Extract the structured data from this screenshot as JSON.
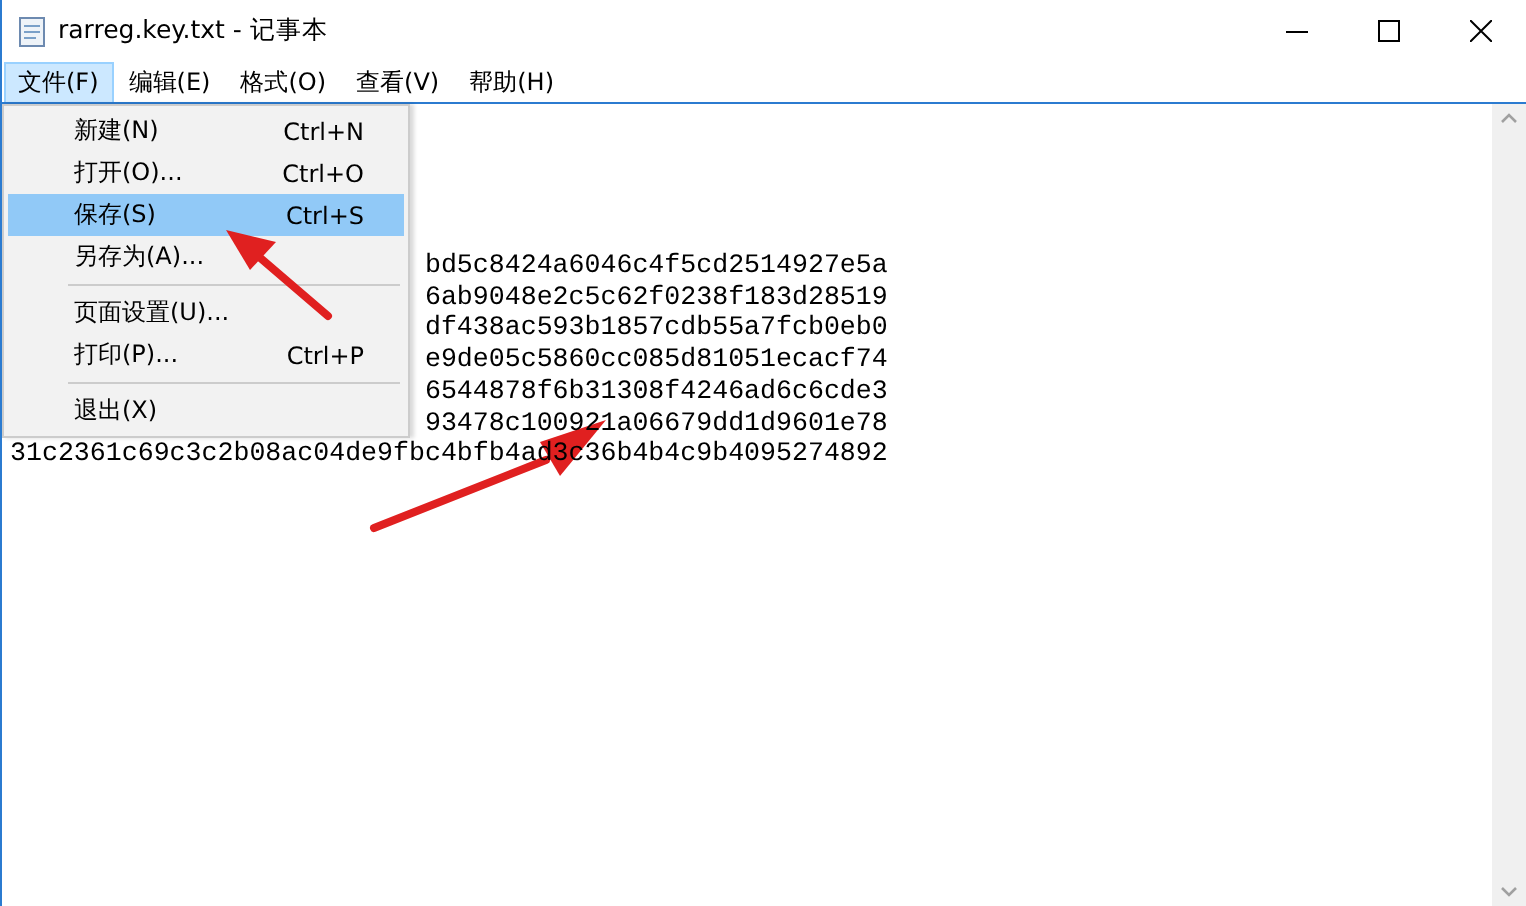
{
  "window": {
    "title": "rarreg.key.txt - 记事本"
  },
  "menu_bar": [
    {
      "label": "文件(F)",
      "selected": true
    },
    {
      "label": "编辑(E)",
      "selected": false
    },
    {
      "label": "格式(O)",
      "selected": false
    },
    {
      "label": "查看(V)",
      "selected": false
    },
    {
      "label": "帮助(H)",
      "selected": false
    }
  ],
  "dropdown": [
    {
      "kind": "item",
      "label": "新建(N)",
      "shortcut": "Ctrl+N",
      "selected": false
    },
    {
      "kind": "item",
      "label": "打开(O)...",
      "shortcut": "Ctrl+O",
      "selected": false
    },
    {
      "kind": "item",
      "label": "保存(S)",
      "shortcut": "Ctrl+S",
      "selected": true
    },
    {
      "kind": "item",
      "label": "另存为(A)...",
      "selected": false
    },
    {
      "kind": "separator"
    },
    {
      "kind": "item",
      "label": "页面设置(U)...",
      "selected": false
    },
    {
      "kind": "item",
      "label": "打印(P)...",
      "shortcut": "Ctrl+P",
      "selected": false
    },
    {
      "kind": "separator"
    },
    {
      "kind": "item",
      "label": "退出(X)",
      "selected": false
    }
  ],
  "editor": {
    "lines": [
      "bd5c8424a6046c4f5cd2514927e5a",
      "6ab9048e2c5c62f0238f183d28519",
      "df438ac593b1857cdb55a7fcb0eb0",
      "e9de05c5860cc085d81051ecacf74",
      "6544878f6b31308f4246ad6c6cde3",
      "93478c100921a06679dd1d9601e78",
      "31c2361c69c3c2b08ac04de9fbc4bfb4ad3c36b4b4c9b4095274892"
    ]
  }
}
